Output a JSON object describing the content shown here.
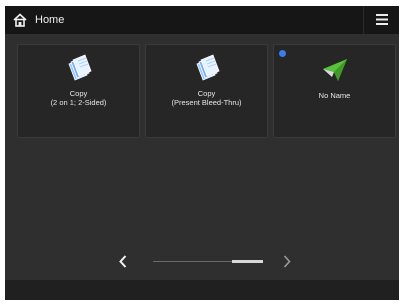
{
  "header": {
    "title": "Home",
    "home_icon": "home-icon",
    "menu_icon": "hamburger-menu-icon"
  },
  "tiles": [
    {
      "line1": "Copy",
      "line2": "(2 on 1; 2-Sided)",
      "icon": "copy-icon"
    },
    {
      "line1": "Copy",
      "line2": "(Present Bleed-Thru)",
      "icon": "copy-icon"
    },
    {
      "line1": "No Name",
      "icon": "send-icon",
      "badge_color": "#3d7bf0"
    }
  ],
  "pager": {
    "prev_icon": "chevron-left-icon",
    "next_icon": "chevron-right-icon"
  },
  "colors": {
    "background": "#2f2f2f",
    "header": "#161616",
    "accent_blue": "#3d7bf0",
    "send_green": "#59c23a"
  }
}
